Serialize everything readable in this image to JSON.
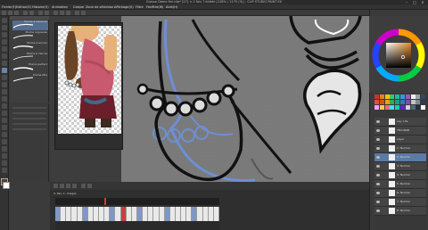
{
  "window": {
    "title": "Grosse Dame fini.clip* [27] × 2 fois 7 éditée [128% / 1170 (9)] - CLIP STUDIO PAINT EX",
    "controls": [
      "–",
      "□",
      "×"
    ]
  },
  "menu": [
    "Fichier(F)",
    "Edition(E)",
    "Histoire(V)",
    "Animation",
    "Calque",
    "Zone de sélection",
    "Affichage(V)",
    "Filtre",
    "Fenêtre(W)",
    "Aide(H)"
  ],
  "subtool": {
    "brushes": [
      {
        "name": "Plume à dessiner"
      },
      {
        "name": "Plume rugueuse"
      },
      {
        "name": "Plume à encrer"
      },
      {
        "name": "Plume à l'encre"
      },
      {
        "name": "Plume perfect"
      },
      {
        "name": "Plume Mar"
      }
    ],
    "selected_index": 0
  },
  "timeline": {
    "label": "0: Pas, 1: images",
    "frame_count": 30,
    "current_frame": 12
  },
  "layers": {
    "items": [
      {
        "name": "Lay 1 Ps"
      },
      {
        "name": "TM-CNAB"
      },
      {
        "name": "Layer"
      },
      {
        "name": "1: Normal"
      },
      {
        "name": "2: Normal"
      },
      {
        "name": "3: Normal"
      },
      {
        "name": "4: Normal"
      },
      {
        "name": "5: Normal"
      },
      {
        "name": "6: Normal"
      },
      {
        "name": "7: Normal"
      },
      {
        "name": "8: Normal"
      }
    ],
    "selected_index": 4
  },
  "colors": {
    "accent": "#5b7aa4",
    "main_color": "#5a3d28",
    "sub_color": "#ffffff",
    "sketch_blue": "#6e8fd4"
  }
}
